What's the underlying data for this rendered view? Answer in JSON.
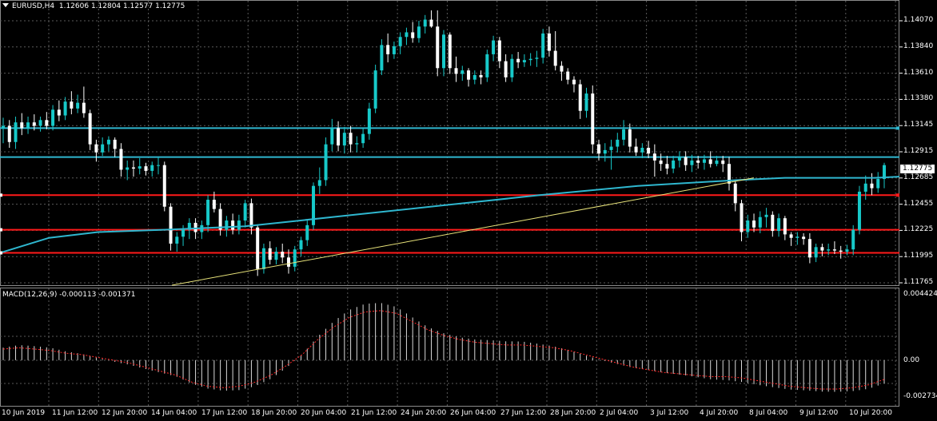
{
  "colors": {
    "background": "#000000",
    "grid": "#5a5a5a",
    "bull": "#17c9c9",
    "bear": "#ffffff",
    "ma": "#2fb7cf",
    "trendline": "#e8e37a",
    "support": "#ff1a1a",
    "resistance": "#2fb7cf",
    "macd_hist": "#d9d9d9",
    "macd_signal": "#ff2a2a",
    "text": "#ffffff"
  },
  "header": {
    "symbol": "EURUSD,H4",
    "ohlc": "1.12606 1.12804 1.12577 1.12775",
    "menu_icon": "triangle-down-icon"
  },
  "main_chart": {
    "price_labels": [
      "1.14070",
      "1.13840",
      "1.13610",
      "1.13380",
      "1.13145",
      "1.12915",
      "1.12685",
      "1.12455",
      "1.12225",
      "1.11995",
      "1.11765"
    ],
    "current_price_label": "1.12775"
  },
  "macd": {
    "title": "MACD(12,26,9) -0.000113 -0.001371",
    "axis_labels": [
      "0.004424",
      "0.00",
      "-0.002734"
    ]
  },
  "time_labels": [
    "10 Jun 2019",
    "11 Jun 12:00",
    "12 Jun 20:00",
    "14 Jun 04:00",
    "17 Jun 12:00",
    "18 Jun 20:00",
    "20 Jun 04:00",
    "21 Jun 12:00",
    "24 Jun 20:00",
    "26 Jun 04:00",
    "27 Jun 12:00",
    "28 Jun 20:00",
    "2 Jul 04:00",
    "3 Jul 12:00",
    "4 Jul 20:00",
    "8 Jul 04:00",
    "9 Jul 12:00",
    "10 Jul 20:00"
  ],
  "chart_data": {
    "type": "candlestick",
    "symbol": "EURUSD",
    "timeframe": "H4",
    "y_range": [
      1.1174,
      1.1412
    ],
    "horizontal_levels": {
      "resistance": [
        1.131,
        1.1285
      ],
      "support": [
        1.1252,
        1.1222,
        1.1202
      ]
    },
    "ma_points": [
      [
        0,
        1.1202
      ],
      [
        60,
        1.1215
      ],
      [
        120,
        1.122
      ],
      [
        200,
        1.1222
      ],
      [
        300,
        1.1225
      ],
      [
        420,
        1.1234
      ],
      [
        540,
        1.1243
      ],
      [
        660,
        1.1252
      ],
      [
        780,
        1.126
      ],
      [
        900,
        1.1265
      ],
      [
        960,
        1.1267
      ],
      [
        1030,
        1.1267
      ],
      [
        1070,
        1.1267
      ],
      [
        1100,
        1.1268
      ]
    ],
    "trendline": [
      [
        0,
        1.1176
      ],
      [
        121,
        1.1267
      ]
    ],
    "candles": [
      {
        "o": 1.131,
        "h": 1.1319,
        "l": 1.1297,
        "c": 1.1312
      },
      {
        "o": 1.1312,
        "h": 1.1317,
        "l": 1.1293,
        "c": 1.1298
      },
      {
        "o": 1.1298,
        "h": 1.132,
        "l": 1.1292,
        "c": 1.1315
      },
      {
        "o": 1.1315,
        "h": 1.1323,
        "l": 1.1304,
        "c": 1.131
      },
      {
        "o": 1.131,
        "h": 1.132,
        "l": 1.1305,
        "c": 1.1315
      },
      {
        "o": 1.1315,
        "h": 1.1322,
        "l": 1.1308,
        "c": 1.1312
      },
      {
        "o": 1.1312,
        "h": 1.132,
        "l": 1.1307,
        "c": 1.1317
      },
      {
        "o": 1.1317,
        "h": 1.1324,
        "l": 1.1309,
        "c": 1.1312
      },
      {
        "o": 1.1312,
        "h": 1.133,
        "l": 1.1308,
        "c": 1.1326
      },
      {
        "o": 1.1326,
        "h": 1.1334,
        "l": 1.1316,
        "c": 1.1321
      },
      {
        "o": 1.1321,
        "h": 1.1337,
        "l": 1.1317,
        "c": 1.1333
      },
      {
        "o": 1.1333,
        "h": 1.1342,
        "l": 1.1322,
        "c": 1.1327
      },
      {
        "o": 1.1327,
        "h": 1.1339,
        "l": 1.1323,
        "c": 1.1332
      },
      {
        "o": 1.1332,
        "h": 1.1346,
        "l": 1.1319,
        "c": 1.1323
      },
      {
        "o": 1.1323,
        "h": 1.1326,
        "l": 1.1291,
        "c": 1.1296
      },
      {
        "o": 1.1296,
        "h": 1.13,
        "l": 1.1281,
        "c": 1.1289
      },
      {
        "o": 1.1289,
        "h": 1.1302,
        "l": 1.1286,
        "c": 1.1296
      },
      {
        "o": 1.1296,
        "h": 1.1303,
        "l": 1.129,
        "c": 1.13
      },
      {
        "o": 1.13,
        "h": 1.1302,
        "l": 1.1285,
        "c": 1.1292
      },
      {
        "o": 1.1292,
        "h": 1.1297,
        "l": 1.1268,
        "c": 1.1274
      },
      {
        "o": 1.1274,
        "h": 1.1282,
        "l": 1.1265,
        "c": 1.1276
      },
      {
        "o": 1.1276,
        "h": 1.1282,
        "l": 1.1268,
        "c": 1.1275
      },
      {
        "o": 1.1275,
        "h": 1.1284,
        "l": 1.127,
        "c": 1.1277
      },
      {
        "o": 1.1277,
        "h": 1.128,
        "l": 1.1269,
        "c": 1.1273
      },
      {
        "o": 1.1273,
        "h": 1.1281,
        "l": 1.1268,
        "c": 1.1278
      },
      {
        "o": 1.1278,
        "h": 1.1285,
        "l": 1.127,
        "c": 1.1278
      },
      {
        "o": 1.1278,
        "h": 1.1281,
        "l": 1.1238,
        "c": 1.1242
      },
      {
        "o": 1.1242,
        "h": 1.1245,
        "l": 1.1204,
        "c": 1.121
      },
      {
        "o": 1.121,
        "h": 1.122,
        "l": 1.1203,
        "c": 1.1216
      },
      {
        "o": 1.1216,
        "h": 1.1226,
        "l": 1.1208,
        "c": 1.1222
      },
      {
        "o": 1.1222,
        "h": 1.1232,
        "l": 1.1214,
        "c": 1.1228
      },
      {
        "o": 1.1228,
        "h": 1.1232,
        "l": 1.1214,
        "c": 1.122
      },
      {
        "o": 1.122,
        "h": 1.123,
        "l": 1.1214,
        "c": 1.1226
      },
      {
        "o": 1.1226,
        "h": 1.1252,
        "l": 1.122,
        "c": 1.1248
      },
      {
        "o": 1.1248,
        "h": 1.1255,
        "l": 1.1237,
        "c": 1.124
      },
      {
        "o": 1.124,
        "h": 1.1245,
        "l": 1.1217,
        "c": 1.1222
      },
      {
        "o": 1.1222,
        "h": 1.1234,
        "l": 1.1216,
        "c": 1.123
      },
      {
        "o": 1.123,
        "h": 1.1236,
        "l": 1.1218,
        "c": 1.1222
      },
      {
        "o": 1.1222,
        "h": 1.1235,
        "l": 1.1218,
        "c": 1.123
      },
      {
        "o": 1.123,
        "h": 1.1248,
        "l": 1.1224,
        "c": 1.1245
      },
      {
        "o": 1.1245,
        "h": 1.1249,
        "l": 1.1218,
        "c": 1.1224
      },
      {
        "o": 1.1224,
        "h": 1.1226,
        "l": 1.1182,
        "c": 1.1188
      },
      {
        "o": 1.1188,
        "h": 1.121,
        "l": 1.1184,
        "c": 1.1206
      },
      {
        "o": 1.1206,
        "h": 1.1212,
        "l": 1.1192,
        "c": 1.1196
      },
      {
        "o": 1.1196,
        "h": 1.1207,
        "l": 1.1192,
        "c": 1.1203
      },
      {
        "o": 1.1203,
        "h": 1.121,
        "l": 1.1193,
        "c": 1.1198
      },
      {
        "o": 1.1198,
        "h": 1.1205,
        "l": 1.1184,
        "c": 1.119
      },
      {
        "o": 1.119,
        "h": 1.1208,
        "l": 1.1186,
        "c": 1.1205
      },
      {
        "o": 1.1205,
        "h": 1.1216,
        "l": 1.1199,
        "c": 1.1213
      },
      {
        "o": 1.1213,
        "h": 1.123,
        "l": 1.1208,
        "c": 1.1226
      },
      {
        "o": 1.1226,
        "h": 1.1263,
        "l": 1.1222,
        "c": 1.126
      },
      {
        "o": 1.126,
        "h": 1.1276,
        "l": 1.1253,
        "c": 1.1265
      },
      {
        "o": 1.1265,
        "h": 1.1302,
        "l": 1.126,
        "c": 1.1296
      },
      {
        "o": 1.1296,
        "h": 1.1318,
        "l": 1.129,
        "c": 1.131
      },
      {
        "o": 1.131,
        "h": 1.1316,
        "l": 1.129,
        "c": 1.1295
      },
      {
        "o": 1.1295,
        "h": 1.1311,
        "l": 1.1288,
        "c": 1.1306
      },
      {
        "o": 1.1306,
        "h": 1.1312,
        "l": 1.1289,
        "c": 1.1296
      },
      {
        "o": 1.1296,
        "h": 1.1303,
        "l": 1.1289,
        "c": 1.1297
      },
      {
        "o": 1.1297,
        "h": 1.131,
        "l": 1.1293,
        "c": 1.1305
      },
      {
        "o": 1.1305,
        "h": 1.1332,
        "l": 1.13,
        "c": 1.1327
      },
      {
        "o": 1.1327,
        "h": 1.1365,
        "l": 1.1323,
        "c": 1.136
      },
      {
        "o": 1.136,
        "h": 1.1387,
        "l": 1.1356,
        "c": 1.1382
      },
      {
        "o": 1.1382,
        "h": 1.1392,
        "l": 1.1367,
        "c": 1.1374
      },
      {
        "o": 1.1374,
        "h": 1.1385,
        "l": 1.137,
        "c": 1.1381
      },
      {
        "o": 1.1381,
        "h": 1.1393,
        "l": 1.1374,
        "c": 1.1389
      },
      {
        "o": 1.1389,
        "h": 1.1397,
        "l": 1.1382,
        "c": 1.1393
      },
      {
        "o": 1.1393,
        "h": 1.1402,
        "l": 1.1384,
        "c": 1.1388
      },
      {
        "o": 1.1388,
        "h": 1.1403,
        "l": 1.1384,
        "c": 1.1398
      },
      {
        "o": 1.1398,
        "h": 1.1408,
        "l": 1.1392,
        "c": 1.1404
      },
      {
        "o": 1.1404,
        "h": 1.1412,
        "l": 1.1397,
        "c": 1.1398
      },
      {
        "o": 1.1398,
        "h": 1.1412,
        "l": 1.1355,
        "c": 1.1362
      },
      {
        "o": 1.1362,
        "h": 1.1395,
        "l": 1.1355,
        "c": 1.1391
      },
      {
        "o": 1.1391,
        "h": 1.1393,
        "l": 1.1357,
        "c": 1.1362
      },
      {
        "o": 1.1362,
        "h": 1.1372,
        "l": 1.135,
        "c": 1.1357
      },
      {
        "o": 1.1357,
        "h": 1.1364,
        "l": 1.1351,
        "c": 1.136
      },
      {
        "o": 1.136,
        "h": 1.1362,
        "l": 1.1346,
        "c": 1.1352
      },
      {
        "o": 1.1352,
        "h": 1.136,
        "l": 1.1348,
        "c": 1.1356
      },
      {
        "o": 1.1356,
        "h": 1.136,
        "l": 1.1348,
        "c": 1.1354
      },
      {
        "o": 1.1354,
        "h": 1.1378,
        "l": 1.135,
        "c": 1.1374
      },
      {
        "o": 1.1374,
        "h": 1.139,
        "l": 1.1368,
        "c": 1.1386
      },
      {
        "o": 1.1386,
        "h": 1.1389,
        "l": 1.1362,
        "c": 1.1368
      },
      {
        "o": 1.1368,
        "h": 1.1374,
        "l": 1.135,
        "c": 1.1354
      },
      {
        "o": 1.1354,
        "h": 1.1374,
        "l": 1.135,
        "c": 1.137
      },
      {
        "o": 1.137,
        "h": 1.1376,
        "l": 1.1362,
        "c": 1.1367
      },
      {
        "o": 1.1367,
        "h": 1.1374,
        "l": 1.1363,
        "c": 1.1369
      },
      {
        "o": 1.1369,
        "h": 1.1375,
        "l": 1.1364,
        "c": 1.137
      },
      {
        "o": 1.137,
        "h": 1.1377,
        "l": 1.1363,
        "c": 1.1371
      },
      {
        "o": 1.1371,
        "h": 1.1396,
        "l": 1.1366,
        "c": 1.1392
      },
      {
        "o": 1.1392,
        "h": 1.1398,
        "l": 1.1372,
        "c": 1.1377
      },
      {
        "o": 1.1377,
        "h": 1.1394,
        "l": 1.136,
        "c": 1.1364
      },
      {
        "o": 1.1364,
        "h": 1.1368,
        "l": 1.1351,
        "c": 1.1359
      },
      {
        "o": 1.1359,
        "h": 1.1362,
        "l": 1.1348,
        "c": 1.1352
      },
      {
        "o": 1.1352,
        "h": 1.1355,
        "l": 1.1341,
        "c": 1.1348
      },
      {
        "o": 1.1348,
        "h": 1.1352,
        "l": 1.1318,
        "c": 1.1325
      },
      {
        "o": 1.1325,
        "h": 1.1345,
        "l": 1.1319,
        "c": 1.134
      },
      {
        "o": 1.134,
        "h": 1.1347,
        "l": 1.1288,
        "c": 1.1296
      },
      {
        "o": 1.1296,
        "h": 1.13,
        "l": 1.1282,
        "c": 1.1288
      },
      {
        "o": 1.1288,
        "h": 1.1297,
        "l": 1.1281,
        "c": 1.1291
      },
      {
        "o": 1.1291,
        "h": 1.13,
        "l": 1.1274,
        "c": 1.1294
      },
      {
        "o": 1.1294,
        "h": 1.1306,
        "l": 1.1289,
        "c": 1.13
      },
      {
        "o": 1.13,
        "h": 1.1317,
        "l": 1.1295,
        "c": 1.1309
      },
      {
        "o": 1.1309,
        "h": 1.1314,
        "l": 1.1289,
        "c": 1.1294
      },
      {
        "o": 1.1294,
        "h": 1.1301,
        "l": 1.1286,
        "c": 1.1289
      },
      {
        "o": 1.1289,
        "h": 1.1297,
        "l": 1.1284,
        "c": 1.1293
      },
      {
        "o": 1.1293,
        "h": 1.1299,
        "l": 1.1284,
        "c": 1.1288
      },
      {
        "o": 1.1288,
        "h": 1.1296,
        "l": 1.1268,
        "c": 1.1282
      },
      {
        "o": 1.1282,
        "h": 1.1288,
        "l": 1.1273,
        "c": 1.1279
      },
      {
        "o": 1.1279,
        "h": 1.1286,
        "l": 1.127,
        "c": 1.1275
      },
      {
        "o": 1.1275,
        "h": 1.1286,
        "l": 1.1271,
        "c": 1.1282
      },
      {
        "o": 1.1282,
        "h": 1.129,
        "l": 1.1276,
        "c": 1.1285
      },
      {
        "o": 1.1285,
        "h": 1.129,
        "l": 1.1273,
        "c": 1.1278
      },
      {
        "o": 1.1278,
        "h": 1.1287,
        "l": 1.1272,
        "c": 1.1282
      },
      {
        "o": 1.1282,
        "h": 1.1286,
        "l": 1.1275,
        "c": 1.128
      },
      {
        "o": 1.128,
        "h": 1.1287,
        "l": 1.1274,
        "c": 1.1283
      },
      {
        "o": 1.1283,
        "h": 1.129,
        "l": 1.1276,
        "c": 1.1279
      },
      {
        "o": 1.1279,
        "h": 1.1286,
        "l": 1.1277,
        "c": 1.1282
      },
      {
        "o": 1.1282,
        "h": 1.1286,
        "l": 1.1272,
        "c": 1.1279
      },
      {
        "o": 1.1279,
        "h": 1.1285,
        "l": 1.1256,
        "c": 1.1262
      },
      {
        "o": 1.1262,
        "h": 1.1264,
        "l": 1.1238,
        "c": 1.1245
      },
      {
        "o": 1.1245,
        "h": 1.1248,
        "l": 1.1212,
        "c": 1.122
      },
      {
        "o": 1.122,
        "h": 1.1235,
        "l": 1.1215,
        "c": 1.123
      },
      {
        "o": 1.123,
        "h": 1.1236,
        "l": 1.122,
        "c": 1.1224
      },
      {
        "o": 1.1224,
        "h": 1.1238,
        "l": 1.1219,
        "c": 1.1233
      },
      {
        "o": 1.1233,
        "h": 1.1241,
        "l": 1.1224,
        "c": 1.1235
      },
      {
        "o": 1.1235,
        "h": 1.1238,
        "l": 1.1216,
        "c": 1.1221
      },
      {
        "o": 1.1221,
        "h": 1.1236,
        "l": 1.1216,
        "c": 1.1232
      },
      {
        "o": 1.1232,
        "h": 1.1234,
        "l": 1.1213,
        "c": 1.1218
      },
      {
        "o": 1.1218,
        "h": 1.122,
        "l": 1.1208,
        "c": 1.1215
      },
      {
        "o": 1.1215,
        "h": 1.122,
        "l": 1.1209,
        "c": 1.1216
      },
      {
        "o": 1.1216,
        "h": 1.1219,
        "l": 1.1209,
        "c": 1.1214
      },
      {
        "o": 1.1214,
        "h": 1.1219,
        "l": 1.1193,
        "c": 1.1198
      },
      {
        "o": 1.1198,
        "h": 1.121,
        "l": 1.1194,
        "c": 1.1207
      },
      {
        "o": 1.1207,
        "h": 1.121,
        "l": 1.1199,
        "c": 1.1204
      },
      {
        "o": 1.1204,
        "h": 1.121,
        "l": 1.12,
        "c": 1.1205
      },
      {
        "o": 1.1205,
        "h": 1.1212,
        "l": 1.1201,
        "c": 1.1204
      },
      {
        "o": 1.1204,
        "h": 1.1208,
        "l": 1.1197,
        "c": 1.1203
      },
      {
        "o": 1.1203,
        "h": 1.1209,
        "l": 1.12,
        "c": 1.1205
      },
      {
        "o": 1.1205,
        "h": 1.1226,
        "l": 1.12,
        "c": 1.1222
      },
      {
        "o": 1.1222,
        "h": 1.126,
        "l": 1.1218,
        "c": 1.1255
      },
      {
        "o": 1.1255,
        "h": 1.1269,
        "l": 1.1248,
        "c": 1.1262
      },
      {
        "o": 1.1262,
        "h": 1.1271,
        "l": 1.1252,
        "c": 1.1258
      },
      {
        "o": 1.1258,
        "h": 1.1272,
        "l": 1.1254,
        "c": 1.1266
      },
      {
        "o": 1.1266,
        "h": 1.128,
        "l": 1.1258,
        "c": 1.1278
      }
    ],
    "macd_range": [
      -0.002734,
      0.004424
    ],
    "macd_signal": [
      0.0008,
      0.0009,
      0.0008,
      0.0007,
      0.0005,
      0.0004,
      0.0002,
      0.0,
      -0.0002,
      -0.0005,
      -0.0008,
      -0.0011,
      -0.0016,
      -0.0019,
      -0.002,
      -0.0019,
      -0.0016,
      -0.0011,
      -0.0004,
      0.0004,
      0.0015,
      0.0024,
      0.0031,
      0.0035,
      0.0036,
      0.0034,
      0.0028,
      0.0022,
      0.0018,
      0.0015,
      0.0013,
      0.0012,
      0.0011,
      0.0011,
      0.001,
      0.0009,
      0.0007,
      0.0004,
      0.0001,
      -0.0002,
      -0.0005,
      -0.0007,
      -0.0009,
      -0.001,
      -0.0011,
      -0.0012,
      -0.0012,
      -0.0013,
      -0.0015,
      -0.0017,
      -0.0019,
      -0.002,
      -0.0021,
      -0.0021,
      -0.002,
      -0.0018,
      -0.0014
    ]
  }
}
